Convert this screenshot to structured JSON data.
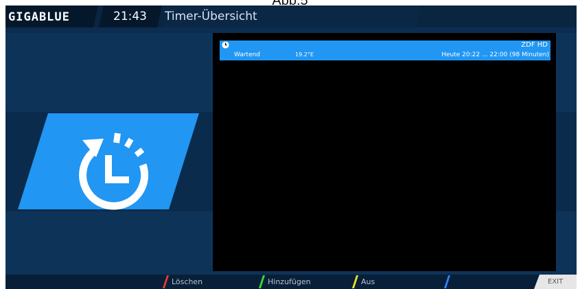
{
  "caption": "Abb.5",
  "header": {
    "logo": "GIGABLUE",
    "clock": "21:43",
    "title": "Timer-Übersicht"
  },
  "timers": [
    {
      "icon": "clock-icon",
      "channel": "ZDF HD",
      "state": "Wartend",
      "orbital_position": "19.2°E",
      "time": "Heute 20:22 ... 22:00 (98 Minuten)"
    }
  ],
  "big_icon": "timer-clock-icon",
  "footer": {
    "keys": [
      {
        "color": "#e53935",
        "label": "Löschen"
      },
      {
        "color": "#43d633",
        "label": "Hinzufügen"
      },
      {
        "color": "#e9e11f",
        "label": "Aus"
      },
      {
        "color": "#2f80ff",
        "label": ""
      }
    ],
    "exit": "EXIT"
  },
  "colors": {
    "background": "#0e3358",
    "highlight": "#2196f3",
    "header": "#05182b"
  }
}
